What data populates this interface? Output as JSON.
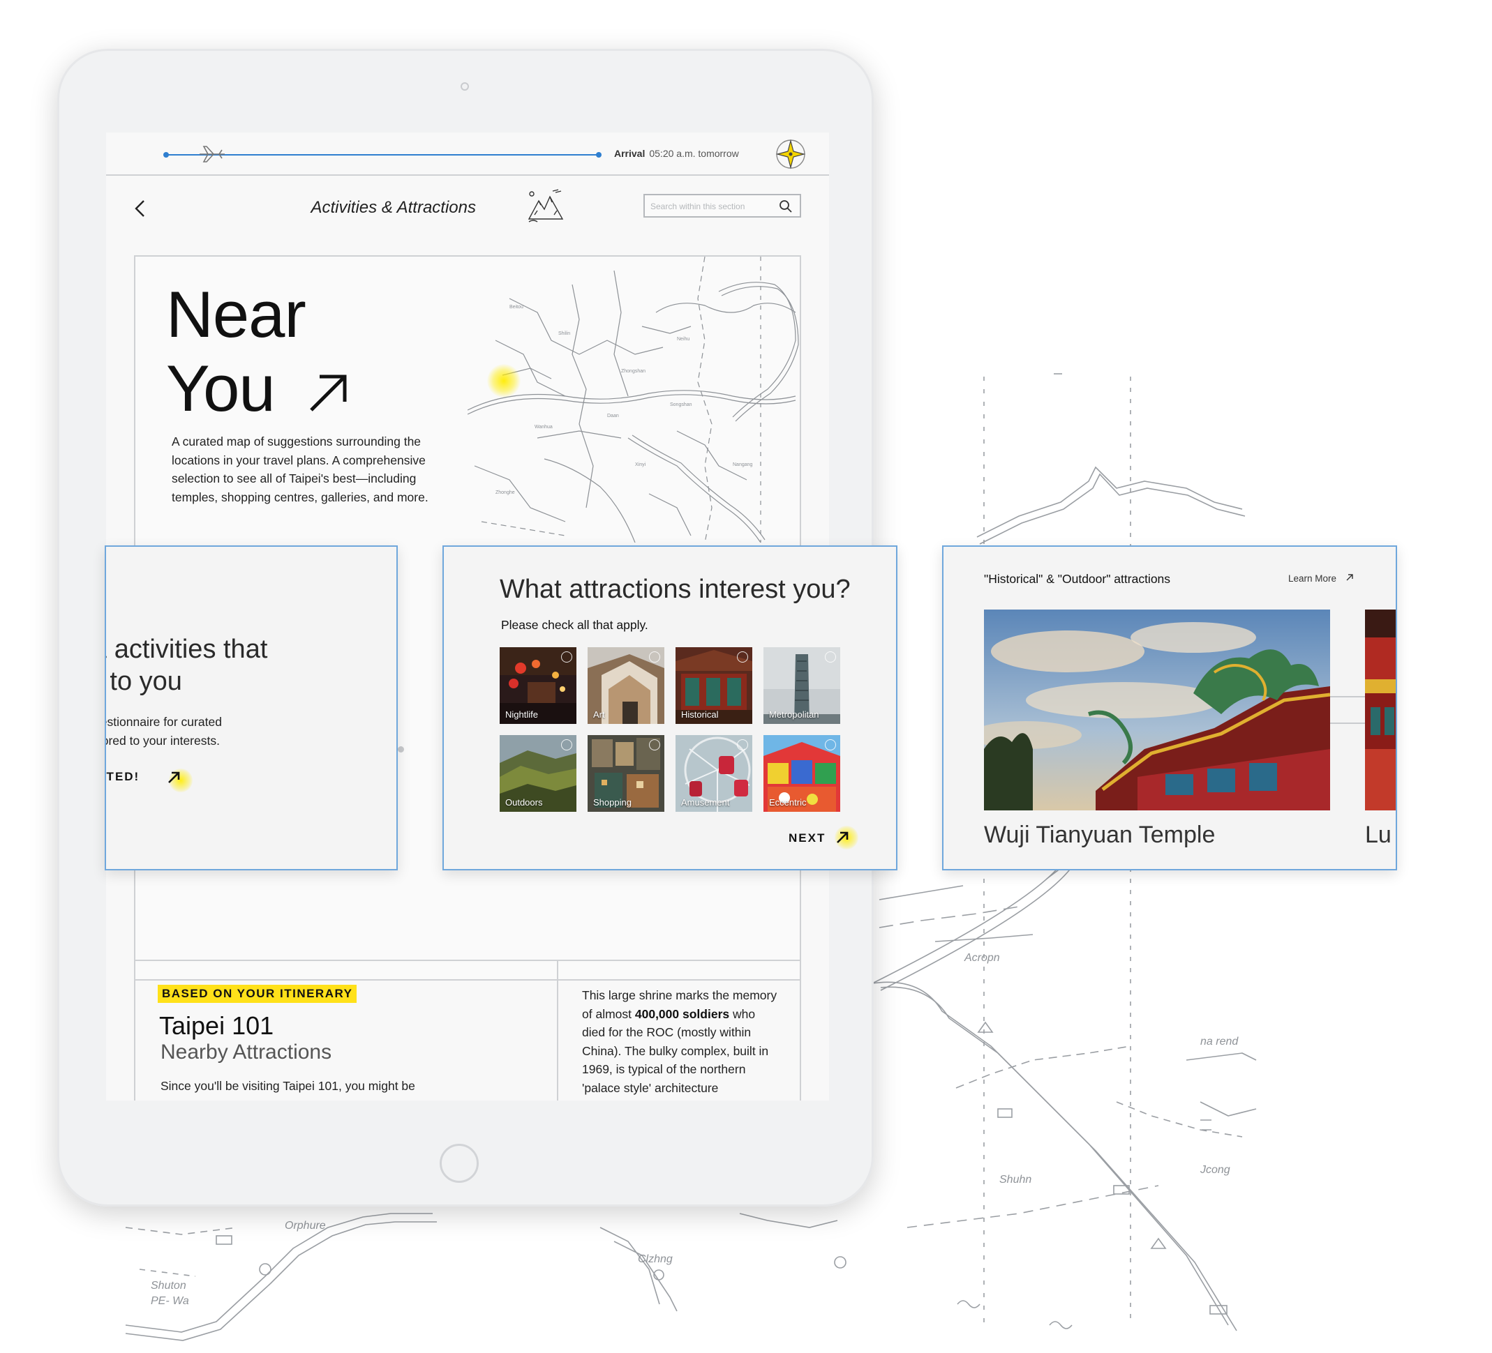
{
  "flight": {
    "arrival_label": "Arrival",
    "arrival_time": "05:20 a.m. tomorrow"
  },
  "header": {
    "title": "Activities & Attractions",
    "search_placeholder": "Search within this section"
  },
  "near_you": {
    "title_line1": "Near",
    "title_line2": "You",
    "description": "A curated map of suggestions surrounding the locations in your travel plans. A comprehensive selection to see all of Taipei's best—including temples, shopping centres, galleries, and more."
  },
  "carousel": {
    "pages": 3,
    "active_page": 1
  },
  "intro_card": {
    "heading_line1": "ons & activities that",
    "heading_line2": "sonal to you",
    "body_line1": "he questionnaire for curated",
    "body_line2": "ns tailored to your interests.",
    "cta": "ARTED!"
  },
  "questionnaire": {
    "heading": "What attractions interest you?",
    "subheading": "Please check all that apply.",
    "options": [
      {
        "label": "Nightlife",
        "checked": false
      },
      {
        "label": "Art",
        "checked": false
      },
      {
        "label": "Historical",
        "checked": false
      },
      {
        "label": "Metropolitan",
        "checked": false
      },
      {
        "label": "Outdoors",
        "checked": false
      },
      {
        "label": "Shopping",
        "checked": false
      },
      {
        "label": "Amusement",
        "checked": false
      },
      {
        "label": "Eccentric",
        "checked": false
      }
    ],
    "next_label": "NEXT"
  },
  "results": {
    "heading": "\"Historical\" & \"Outdoor\" attractions",
    "learn_more": "Learn More",
    "items": [
      {
        "name": "Wuji Tianyuan Temple"
      },
      {
        "name": "Lu"
      }
    ]
  },
  "itinerary": {
    "badge": "BASED ON YOUR ITINERARY",
    "title": "Taipei 101",
    "subtitle": "Nearby Attractions",
    "body": "Since you'll be visiting Taipei 101, you might be",
    "shrine_text_1": "This large shrine marks the memory of almost ",
    "shrine_bold_1": "400,000 soldiers",
    "shrine_text_2": " who died for the ROC (mostly within China). The bulky complex, built in 1969, is typical of the northern 'palace style' architecture popularised during"
  },
  "colors": {
    "accent_blue": "#2f7fd0",
    "card_border": "#6fa7dc",
    "highlight_yellow": "#ffe11a"
  },
  "icons": [
    "plane-icon",
    "compass-icon",
    "back-icon",
    "mountain-icon",
    "search-icon",
    "ne-arrow-icon",
    "van-icon",
    "external-link-icon"
  ]
}
